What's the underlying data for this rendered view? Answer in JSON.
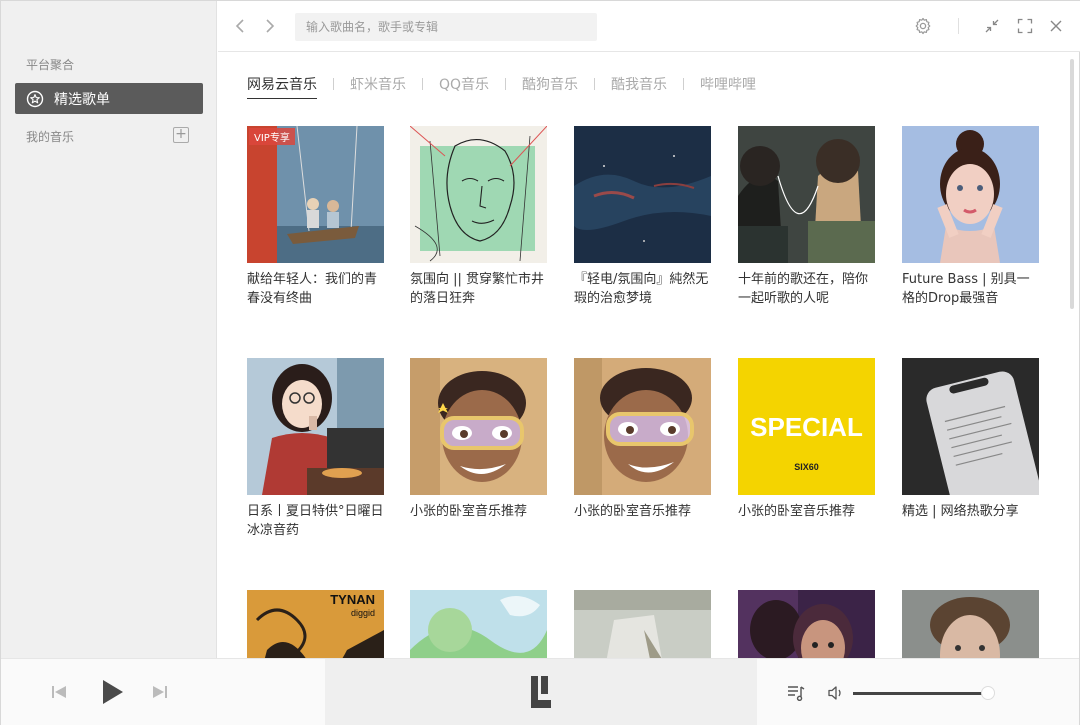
{
  "sidebar": {
    "section_platform": "平台聚合",
    "active_item": "精选歌单",
    "section_my_music": "我的音乐"
  },
  "search": {
    "placeholder": "输入歌曲名，歌手或专辑"
  },
  "tabs": [
    "网易云音乐",
    "虾米音乐",
    "QQ音乐",
    "酷狗音乐",
    "酷我音乐",
    "哔哩哔哩"
  ],
  "playlists": [
    {
      "title": "献给年轻人：我们的青春没有终曲",
      "badge": "VIP专享",
      "cover": "swing"
    },
    {
      "title": "氛围向 || 贯穿繁忙市井的落日狂奔",
      "cover": "sketch-face"
    },
    {
      "title": "『轻电/氛围向』純然无瑕的治愈梦境",
      "cover": "dark-sky"
    },
    {
      "title": "十年前的歌还在，陪你一起听歌的人呢",
      "cover": "earphones"
    },
    {
      "title": "Future Bass | 别具一格的Drop最强音",
      "cover": "girl-portrait"
    },
    {
      "title": "日系丨夏日特供°日曜日冰凉音药",
      "cover": "anime-girl"
    },
    {
      "title": "小张的卧室音乐推荐",
      "cover": "memoji-1"
    },
    {
      "title": "小张的卧室音乐推荐",
      "cover": "memoji-2"
    },
    {
      "title": "小张的卧室音乐推荐",
      "cover": "special-yellow",
      "cover_text": "SPECIAL",
      "cover_subtext": "SIX60"
    },
    {
      "title": "精选 | 网络热歌分享",
      "cover": "phone-notes"
    },
    {
      "title": "",
      "cover": "tynan-art",
      "cover_text": "TYNAN",
      "cover_subtext": "diggid"
    },
    {
      "title": "",
      "cover": "green-sky"
    },
    {
      "title": "",
      "cover": "grey-photo"
    },
    {
      "title": "",
      "cover": "purple-portrait"
    },
    {
      "title": "",
      "cover": "man-portrait"
    }
  ],
  "icons": [
    "back-icon",
    "forward-icon",
    "settings-icon",
    "compact-icon",
    "fullscreen-icon",
    "close-icon",
    "prev-icon",
    "play-icon",
    "next-icon",
    "playlist-icon",
    "volume-icon",
    "logo-icon"
  ],
  "player": {
    "volume_level": 0.95
  },
  "colors": {
    "sidebar_active": "#5b5b5b",
    "sidebar_bg": "#f0f0f0",
    "special_yellow": "#f4d400"
  }
}
